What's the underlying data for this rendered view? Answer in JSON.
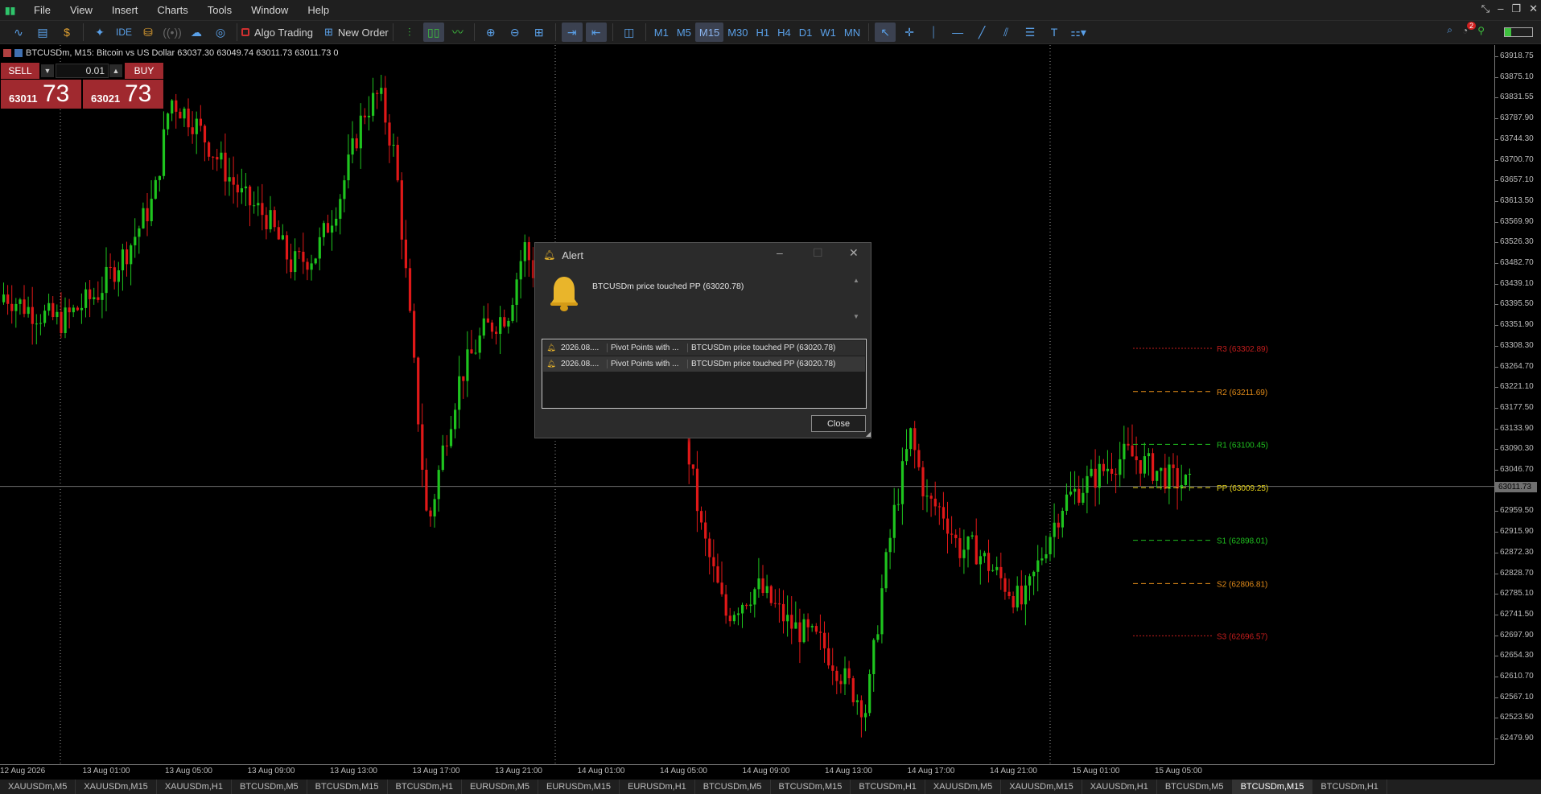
{
  "menu": [
    "File",
    "View",
    "Insert",
    "Charts",
    "Tools",
    "Window",
    "Help"
  ],
  "notifications_count": "2",
  "toolbar": {
    "algo_trading_label": "Algo Trading",
    "new_order_label": "New Order",
    "ide_label": "IDE",
    "timeframes": [
      "M1",
      "M5",
      "M15",
      "M30",
      "H1",
      "H4",
      "D1",
      "W1",
      "MN"
    ],
    "active_timeframe": "M15"
  },
  "chart": {
    "title": "BTCUSDm, M15:  Bitcoin vs US Dollar  63037.30 63049.74 63011.73 63011.73  0",
    "current_price": "63011.73",
    "price_labels": [
      "63918.75",
      "63875.10",
      "63831.55",
      "63787.90",
      "63744.30",
      "63700.70",
      "63657.10",
      "63613.50",
      "63569.90",
      "63526.30",
      "63482.70",
      "63439.10",
      "63395.50",
      "63351.90",
      "63308.30",
      "63264.70",
      "63221.10",
      "63177.50",
      "63133.90",
      "63090.30",
      "63046.70",
      "63003.10",
      "62959.50",
      "62915.90",
      "62872.30",
      "62828.70",
      "62785.10",
      "62741.50",
      "62697.90",
      "62654.30",
      "62610.70",
      "62567.10",
      "62523.50",
      "62479.90"
    ],
    "time_labels": [
      "12 Aug 2026",
      "13 Aug 01:00",
      "13 Aug 05:00",
      "13 Aug 09:00",
      "13 Aug 13:00",
      "13 Aug 17:00",
      "13 Aug 21:00",
      "14 Aug 01:00",
      "14 Aug 05:00",
      "14 Aug 09:00",
      "14 Aug 13:00",
      "14 Aug 17:00",
      "14 Aug 21:00",
      "15 Aug 01:00",
      "15 Aug 05:00"
    ],
    "pivots": [
      {
        "label": "R3 (63302.89)",
        "color": "#c41d1d"
      },
      {
        "label": "R2 (63211.69)",
        "color": "#e08a19"
      },
      {
        "label": "R1 (63100.45)",
        "color": "#1fbf1f"
      },
      {
        "label": "PP (63009.25)",
        "color": "#e5d219"
      },
      {
        "label": "S1 (62898.01)",
        "color": "#1fbf1f"
      },
      {
        "label": "S2 (62806.81)",
        "color": "#e08a19"
      },
      {
        "label": "S3 (62696.57)",
        "color": "#c41d1d"
      }
    ],
    "bull_color": "#1ec41e",
    "bear_color": "#e01818"
  },
  "trade_panel": {
    "sell_label": "SELL",
    "buy_label": "BUY",
    "lot": "0.01",
    "sell_price_small": "63011",
    "sell_price_big": "73",
    "buy_price_small": "63021",
    "buy_price_big": "73"
  },
  "alert": {
    "title": "Alert",
    "message": "BTCUSDm price touched PP (63020.78)",
    "rows": [
      {
        "time": "2026.08....",
        "expert": "Pivot Points with ...",
        "message": "BTCUSDm price touched PP (63020.78)"
      },
      {
        "time": "2026.08....",
        "expert": "Pivot Points with ...",
        "message": "BTCUSDm price touched PP (63020.78)"
      }
    ],
    "close_label": "Close"
  },
  "tabs": [
    "XAUUSDm,M5",
    "XAUUSDm,M15",
    "XAUUSDm,H1",
    "BTCUSDm,M5",
    "BTCUSDm,M15",
    "BTCUSDm,H1",
    "EURUSDm,M5",
    "EURUSDm,M15",
    "EURUSDm,H1",
    "BTCUSDm,M5",
    "BTCUSDm,M15",
    "BTCUSDm,H1",
    "XAUUSDm,M5",
    "XAUUSDm,M15",
    "XAUUSDm,H1",
    "BTCUSDm,M5",
    "BTCUSDm,M15",
    "BTCUSDm,H1"
  ],
  "active_tab": "BTCUSDm,M15"
}
